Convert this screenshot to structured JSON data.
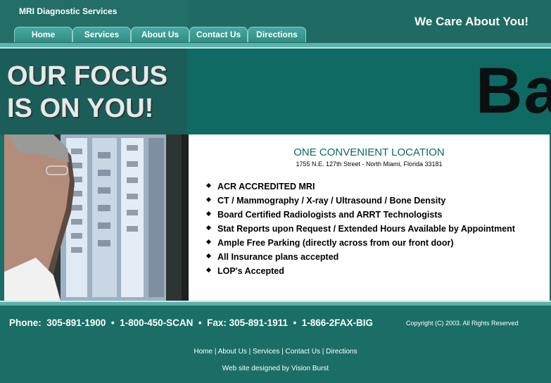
{
  "header": {
    "site_name": "MRI Diagnostic Services",
    "slogan": "We Care About You!"
  },
  "nav": {
    "tabs": [
      {
        "label": "Home"
      },
      {
        "label": "Services"
      },
      {
        "label": "About Us"
      },
      {
        "label": "Contact Us"
      },
      {
        "label": "Directions"
      }
    ]
  },
  "banner": {
    "focus_line1": "OUR FOCUS",
    "focus_line2": "IS ON YOU!",
    "big_text": "Ba"
  },
  "main": {
    "location_title": "ONE CONVENIENT LOCATION",
    "address": "1755 N.E. 127th Street - North Miami, Florida 33181",
    "features": [
      "ACR ACCREDITED MRI",
      "CT / Mammography / X-ray / Ultrasound / Bone Density",
      "Board Certified Radiologists and ARRT Technologists",
      "Stat Reports upon Request / Extended Hours Available by Appointment",
      "Ample Free Parking (directly across from our front door)",
      "All Insurance plans accepted",
      "LOP's Accepted"
    ]
  },
  "contact": {
    "phone_label": "Phone:",
    "phone": "305-891-1900",
    "toll_free": "1-800-450-SCAN",
    "fax_label": "Fax:",
    "fax": "305-891-1911",
    "fax_toll_free": "1-866-2FAX-BIG",
    "copyright": "Copyright (C) 2003. All Rights Reserved"
  },
  "footer": {
    "links": [
      "Home",
      "About Us",
      "Services",
      "Contact Us",
      "Directions"
    ],
    "credit": "Web site designed by Vision Burst"
  },
  "colors": {
    "teal_background": "#1b6e66",
    "banner_teal": "#0f6a63",
    "tab_teal": "#3a9a92",
    "title_teal": "#0e6a63"
  }
}
